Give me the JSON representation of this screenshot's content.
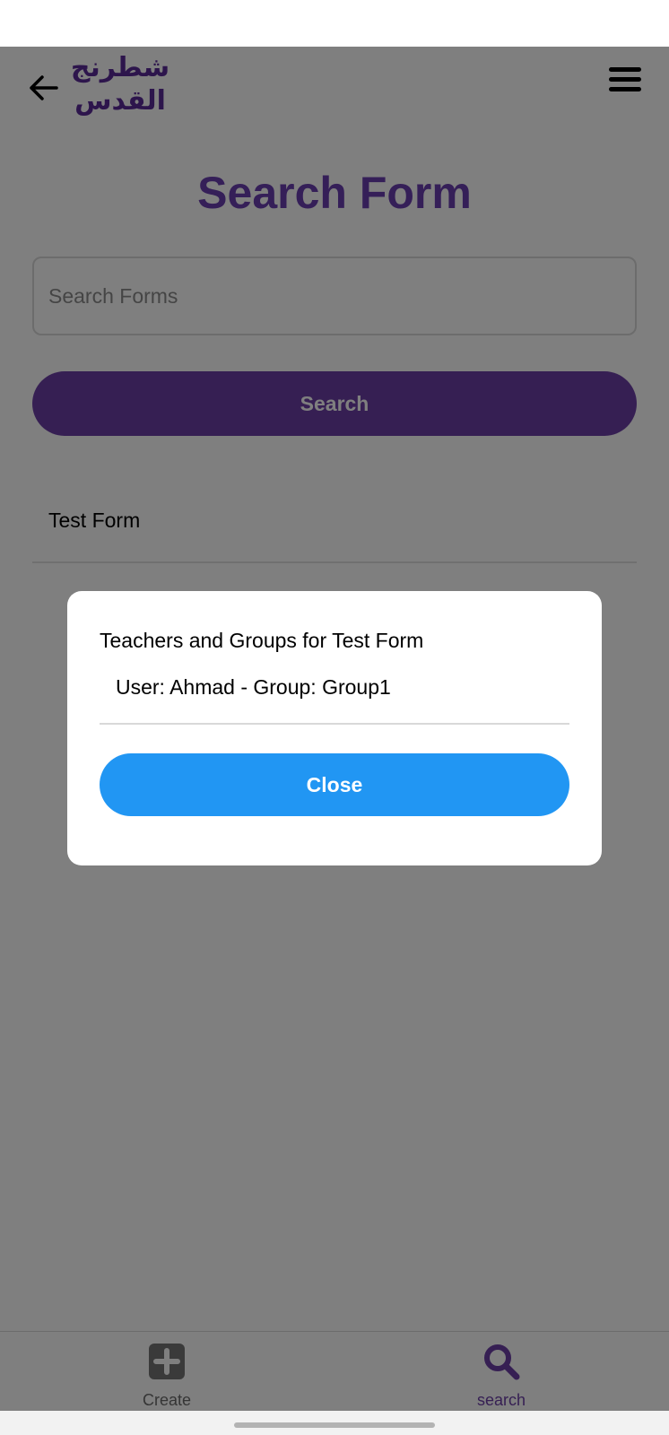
{
  "header": {
    "logo_text_top": "شطرنج",
    "logo_text_bottom": "القدس"
  },
  "page": {
    "title": "Search Form",
    "search_placeholder": "Search Forms",
    "search_button_label": "Search",
    "results": [
      "Test Form"
    ]
  },
  "dialog": {
    "title": "Teachers and Groups for Test Form",
    "rows": [
      "User: Ahmad - Group:  Group1"
    ],
    "close_label": "Close"
  },
  "bottom_nav": {
    "items": [
      {
        "label": "Create",
        "icon": "plus-square-icon"
      },
      {
        "label": "search",
        "icon": "search-icon"
      }
    ]
  },
  "colors": {
    "brand_purple": "#6c3fa7",
    "accent_blue": "#2196f3",
    "overlay": "rgba(0,0,0,0.5)"
  }
}
